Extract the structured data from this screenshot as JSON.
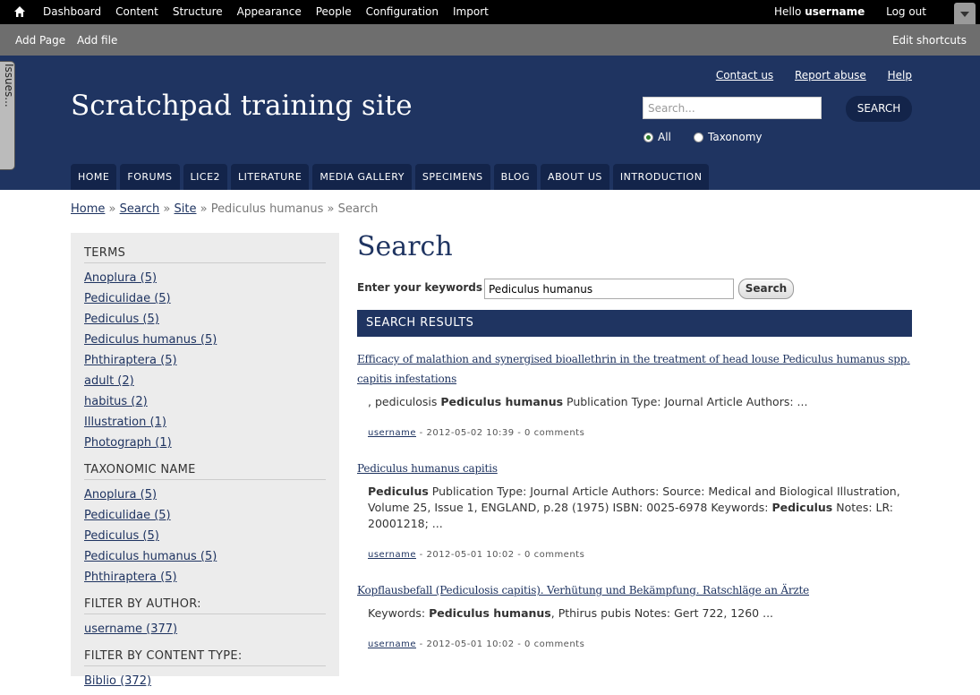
{
  "toolbar": {
    "menu": [
      "Dashboard",
      "Content",
      "Structure",
      "Appearance",
      "People",
      "Configuration",
      "Import"
    ],
    "hello": "Hello",
    "username": "username",
    "logout": "Log out"
  },
  "shortcuts": {
    "items": [
      "Add Page",
      "Add file"
    ],
    "edit": "Edit shortcuts"
  },
  "issues_tab": "Issues...",
  "header": {
    "site_name": "Scratchpad training site",
    "links": [
      "Contact us",
      "Report abuse",
      "Help"
    ],
    "search_placeholder": "Search...",
    "search_button": "SEARCH",
    "radio_all": "All",
    "radio_taxonomy": "Taxonomy"
  },
  "main_menu": [
    "HOME",
    "FORUMS",
    "LICE2",
    "LITERATURE",
    "MEDIA GALLERY",
    "SPECIMENS",
    "BLOG",
    "ABOUT US",
    "INTRODUCTION"
  ],
  "breadcrumb": {
    "home": "Home",
    "search": "Search",
    "site": "Site",
    "current": "Pediculus humanus » Search"
  },
  "sidebar": {
    "terms_title": "TERMS",
    "terms": [
      "Anoplura (5)",
      "Pediculidae (5)",
      "Pediculus (5)",
      "Pediculus humanus (5)",
      "Phthiraptera (5)",
      "adult (2)",
      "habitus (2)",
      "Illustration (1)",
      "Photograph (1)"
    ],
    "taxon_title": "TAXONOMIC NAME",
    "taxa": [
      "Anoplura (5)",
      "Pediculidae (5)",
      "Pediculus (5)",
      "Pediculus humanus (5)",
      "Phthiraptera (5)"
    ],
    "author_title": "FILTER BY AUTHOR:",
    "authors": [
      "username (377)"
    ],
    "type_title": "FILTER BY CONTENT TYPE:",
    "types": [
      "Biblio (372)"
    ]
  },
  "content": {
    "title": "Search",
    "keyword_label": "Enter your keywords",
    "keyword_value": "Pediculus humanus",
    "search_button": "Search",
    "results_header": "SEARCH RESULTS"
  },
  "results": [
    {
      "title": "Efficacy of malathion and synergised bioallethrin in the treatment of head louse Pediculus humanus spp. capitis infestations",
      "snippet_pre": ", pediculosis ",
      "snippet_bold": "Pediculus humanus",
      "snippet_post": " Publication Type: Journal Article Authors: ...",
      "user": "username",
      "meta": " - 2012-05-02 10:39 - 0 comments"
    },
    {
      "title": "Pediculus humanus capitis",
      "snippet_bold1": "Pediculus",
      "snippet_mid": " Publication Type: Journal Article Authors: Source: Medical and Biological Illustration, Volume 25, Issue 1, ENGLAND, p.28 (1975) ISBN: 0025-6978 Keywords: ",
      "snippet_bold2": "Pediculus",
      "snippet_post": " Notes: LR: 20001218; ...",
      "user": "username",
      "meta": " - 2012-05-01 10:02 - 0 comments"
    },
    {
      "title": "Kopflausbefall (Pediculosis capitis). Verhütung und Bekämpfung. Ratschläge an Ärzte",
      "snippet_pre": "Keywords: ",
      "snippet_bold": "Pediculus humanus",
      "snippet_post": ", Pthirus pubis Notes: Gert 722, 1260 ...",
      "user": "username",
      "meta": " - 2012-05-01 10:02 - 0 comments"
    }
  ]
}
